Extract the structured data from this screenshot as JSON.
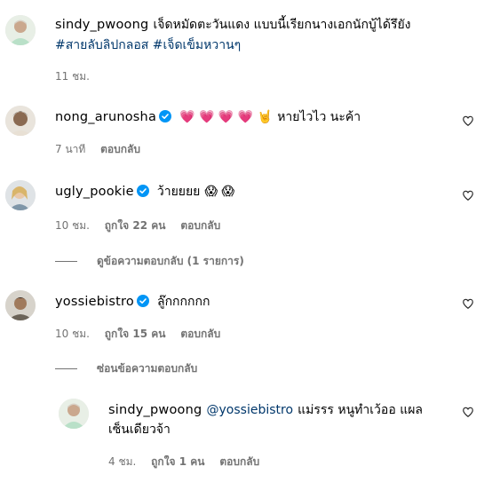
{
  "comments": [
    {
      "username": "sindy_pwoong",
      "text": "เจ็ดหมัดตะวันแดง แบบนี้เรียกนางเอกนักบู้ได้รึยัง",
      "hashtags": "#สายลับลิปกลอส #เจ็ดเข็มหวานๆ",
      "time": "11 ชม."
    },
    {
      "username": "nong_arunosha",
      "verified": true,
      "emojis": "💗 💗 💗 💗 🤘",
      "text": "หายไวไว นะค้า",
      "time": "7 นาที",
      "reply": "ตอบกลับ"
    },
    {
      "username": "ugly_pookie",
      "verified": true,
      "text": "ว้ายยยย",
      "emojis": "😱 😱",
      "time": "10 ชม.",
      "likes": "ถูกใจ 22 คน",
      "reply": "ตอบกลับ",
      "view_replies": "ดูข้อความตอบกลับ (1 รายการ)"
    },
    {
      "username": "yossiebistro",
      "verified": true,
      "text": "ลู๊กกกกกก",
      "time": "10 ชม.",
      "likes": "ถูกใจ 15 คน",
      "reply": "ตอบกลับ",
      "hide_replies": "ซ่อนข้อความตอบกลับ"
    },
    {
      "username": "sindy_pwoong",
      "mention": "@yossiebistro",
      "text_line1": "แม่รรร หนูทำเว้ออ แผล",
      "text_line2": "เซ็นเดียวจ้า",
      "time": "4 ชม.",
      "likes": "ถูกใจ 1 คน",
      "reply": "ตอบกลับ"
    }
  ],
  "colors": {
    "link": "#00376b",
    "meta": "#737373",
    "verified": "#0095f6"
  }
}
